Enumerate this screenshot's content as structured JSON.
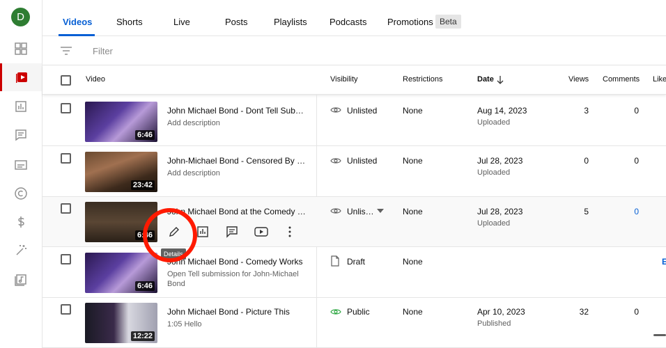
{
  "avatar_letter": "D",
  "colors": {
    "accent": "#065fd4",
    "active_rail": "#cc0000",
    "public_green": "#2ba640",
    "annotation": "#ff1a00"
  },
  "tabs": [
    {
      "label": "Videos"
    },
    {
      "label": "Shorts"
    },
    {
      "label": "Live"
    },
    {
      "label": "Posts"
    },
    {
      "label": "Playlists"
    },
    {
      "label": "Podcasts"
    },
    {
      "label": "Promotions"
    }
  ],
  "beta_badge": "Beta",
  "filter": {
    "placeholder": "Filter"
  },
  "columns": {
    "video": "Video",
    "visibility": "Visibility",
    "restrictions": "Restrictions",
    "date": "Date",
    "views": "Views",
    "comments": "Comments",
    "likes": "Like"
  },
  "rows": [
    {
      "title": "John Michael Bond - Dont Tell Submis…",
      "desc": "Add description",
      "duration": "6:46",
      "visibility": "Unlisted",
      "vis_icon": "eye-icon",
      "restrictions": "None",
      "date": "Aug 14, 2023",
      "status": "Uploaded",
      "views": "3",
      "comments": "0"
    },
    {
      "title": "John-Michael Bond - Censored By My …",
      "desc": "Add description",
      "duration": "23:42",
      "visibility": "Unlisted",
      "vis_icon": "eye-icon",
      "restrictions": "None",
      "date": "Jul 28, 2023",
      "status": "Uploaded",
      "views": "0",
      "comments": "0"
    },
    {
      "title": "John Michael Bond at the Comedy For…",
      "desc": "",
      "duration": "6:46",
      "visibility": "Unlis…",
      "vis_icon": "eye-icon",
      "restrictions": "None",
      "date": "Jul 28, 2023",
      "status": "Uploaded",
      "views": "5",
      "comments": "0"
    },
    {
      "title": "John Michael Bond - Comedy Works",
      "desc": "Open Tell submission for John-Michael Bond",
      "duration": "6:46",
      "visibility": "Draft",
      "vis_icon": "document-icon",
      "restrictions": "None",
      "date": "",
      "status": "",
      "views": "",
      "comments": ""
    },
    {
      "title": "John Michael Bond - Picture This",
      "desc": "1:05 Hello",
      "duration": "12:22",
      "visibility": "Public",
      "vis_icon": "eye-icon",
      "restrictions": "None",
      "date": "Apr 10, 2023",
      "status": "Published",
      "views": "32",
      "comments": "0"
    }
  ],
  "tooltip": "Details",
  "edge_link": "E"
}
